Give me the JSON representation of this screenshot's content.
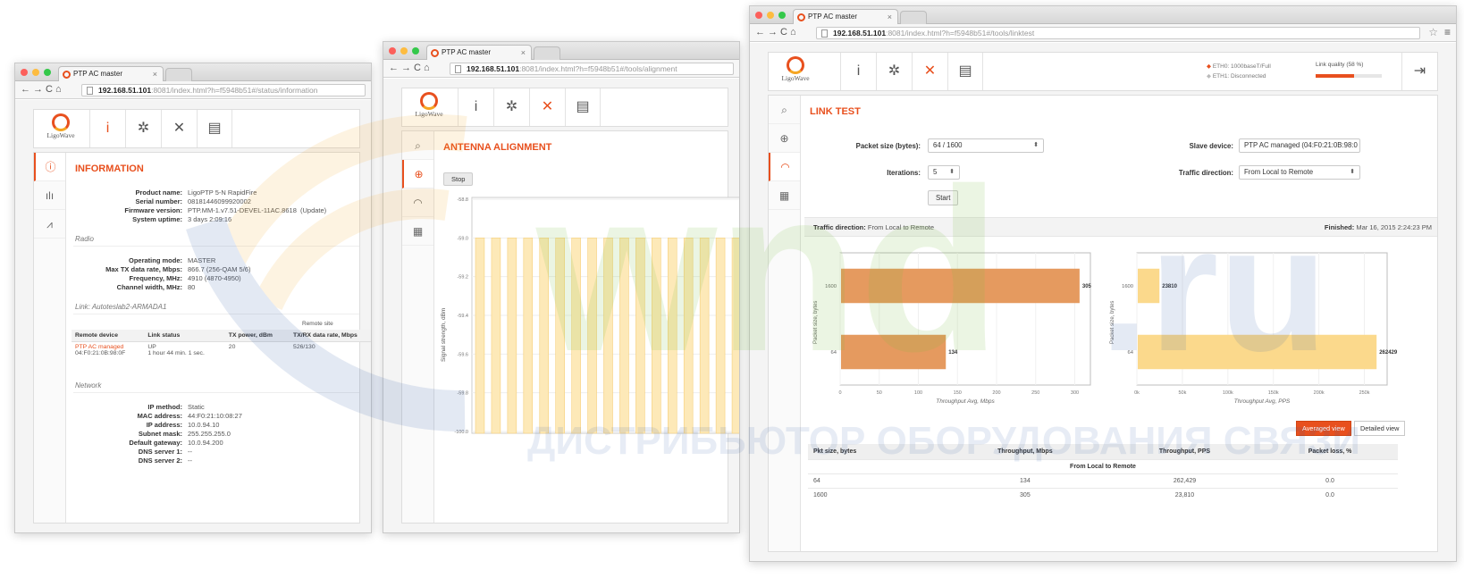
{
  "tab_title": "PTP AC master",
  "win1": {
    "url_host": "192.168.51.101",
    "url_rest": ":8081/index.html?h=f5948b51#/status/information",
    "logo_text": "LigoWave",
    "title": "INFORMATION",
    "general": [
      {
        "k": "Product name:",
        "v": "LigoPTP 5-N RapidFire"
      },
      {
        "k": "Serial number:",
        "v": "08181446099920002"
      },
      {
        "k": "Firmware version:",
        "v": "PTP.MM-1.v7.51-DEVEL-11AC.8618"
      },
      {
        "k": "System uptime:",
        "v": "3 days 2:09:16"
      }
    ],
    "update_label": "(Update)",
    "radio_label": "Radio",
    "radio": [
      {
        "k": "Operating mode:",
        "v": "MASTER"
      },
      {
        "k": "Max TX data rate, Mbps:",
        "v": "866.7 (256-QAM 5/6)"
      },
      {
        "k": "Frequency, MHz:",
        "v": "4910 (4870-4950)"
      },
      {
        "k": "Channel width, MHz:",
        "v": "80"
      }
    ],
    "link_label": "Link: Autoteslab2-ARMADA1",
    "remote_site": "Remote site",
    "link_headers": [
      "Remote device",
      "Link status",
      "TX power, dBm",
      "TX/RX data rate, Mbps"
    ],
    "link_row": {
      "device": "PTP AC managed",
      "mac": "04:F0:21:0B:98:0F",
      "status": "UP",
      "uptime": "1 hour 44 min. 1 sec.",
      "tx_power": "20",
      "rate": "526/130"
    },
    "network_label": "Network",
    "network": [
      {
        "k": "IP method:",
        "v": "Static"
      },
      {
        "k": "MAC address:",
        "v": "44:F0:21:10:08:27"
      },
      {
        "k": "IP address:",
        "v": "10.0.94.10"
      },
      {
        "k": "Subnet mask:",
        "v": "255.255.255.0"
      },
      {
        "k": "Default gateway:",
        "v": "10.0.94.200"
      },
      {
        "k": "DNS server 1:",
        "v": "--"
      },
      {
        "k": "DNS server 2:",
        "v": "--"
      }
    ]
  },
  "win2": {
    "url_host": "192.168.51.101",
    "url_rest": ":8081/index.html?h=f5948b51#/tools/alignment",
    "logo_text": "LigoWave",
    "title": "ANTENNA ALIGNMENT",
    "stop_label": "Stop",
    "ylabel": "Signal strength, dBm",
    "yticks": [
      "-58.8",
      "-59.0",
      "-59.2",
      "-59.4",
      "-59.6",
      "-59.8",
      "-100.0"
    ]
  },
  "win3": {
    "url_host": "192.168.51.101",
    "url_rest": ":8081/index.html?h=f5948b51#/tools/linktest",
    "logo_text": "LigoWave",
    "title": "LINK TEST",
    "eth0": "ETH0: 1000baseT/Full",
    "eth1": "ETH1: Disconnected",
    "link_quality": "Link quality (58 %)",
    "link_quality_pct": 58,
    "packet_size_label": "Packet size (bytes):",
    "packet_size_value": "64 / 1600",
    "iterations_label": "Iterations:",
    "iterations_value": "5",
    "start_label": "Start",
    "slave_label": "Slave device:",
    "slave_value": "PTP AC managed (04:F0:21:0B:98:0",
    "traffic_label": "Traffic direction:",
    "traffic_value": "From Local to Remote",
    "strip_dir_label": "Traffic direction:",
    "strip_dir_value": "From Local to Remote",
    "strip_fin_label": "Finished:",
    "strip_fin_value": "Mar 16, 2015 2:24:23 PM",
    "averaged_view": "Averaged view",
    "detailed_view": "Detailed view",
    "table_headers": [
      "Pkt size, bytes",
      "Throughput, Mbps",
      "Throughput, PPS",
      "Packet loss, %"
    ],
    "table_sub": "From Local to Remote",
    "table_rows": [
      [
        "64",
        "134",
        "262,429",
        "0.0"
      ],
      [
        "1600",
        "305",
        "23,810",
        "0.0"
      ]
    ]
  },
  "chart_data": [
    {
      "type": "bar",
      "orientation": "horizontal",
      "categories": [
        "1600",
        "64"
      ],
      "values": [
        305,
        134
      ],
      "xlabel": "Throughput Avg, Mbps",
      "ylabel": "Packet size, bytes",
      "xlim": [
        0,
        320
      ],
      "xticks": [
        "0",
        "50",
        "100",
        "150",
        "200",
        "250",
        "300"
      ],
      "color": "#e59a5f"
    },
    {
      "type": "bar",
      "orientation": "horizontal",
      "categories": [
        "1600",
        "64"
      ],
      "values": [
        23810,
        262429
      ],
      "xlabel": "Throughput Avg, PPS",
      "ylabel": "Packet size, bytes",
      "xlim": [
        0,
        275000
      ],
      "xticks": [
        "0k",
        "50k",
        "100k",
        "150k",
        "200k",
        "250k"
      ],
      "color": "#fbd98c"
    }
  ],
  "watermark": {
    "brand": "wnd",
    "tld": ".ru",
    "slogan": "ДИСТРИБЬЮТОР ОБОРУДОВАНИЯ СВЯЗИ"
  }
}
